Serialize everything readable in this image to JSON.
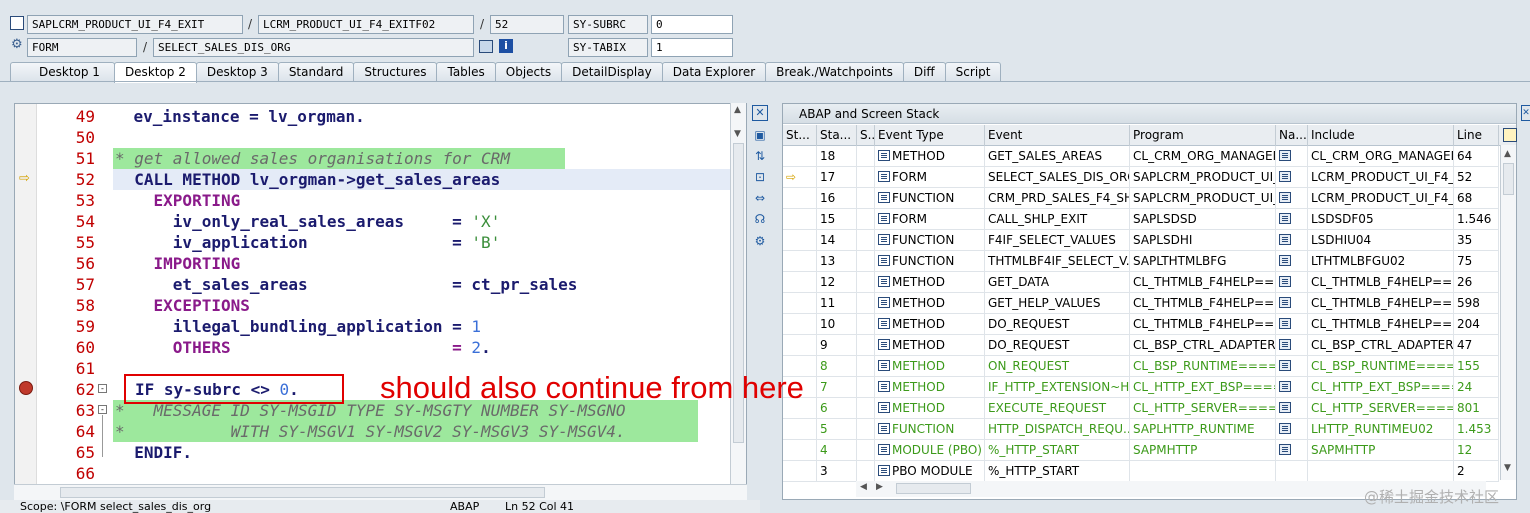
{
  "header": {
    "row1": {
      "program": "SAPLCRM_PRODUCT_UI_F4_EXIT",
      "include": "LCRM_PRODUCT_UI_F4_EXITF02",
      "line": "52",
      "sysvar_label": "SY-SUBRC",
      "sysvar_value": "0"
    },
    "row2": {
      "type": "FORM",
      "name": "SELECT_SALES_DIS_ORG",
      "sysvar_label": "SY-TABIX",
      "sysvar_value": "1"
    },
    "sep": "/"
  },
  "tabs": [
    "Desktop 1",
    "Desktop 2",
    "Desktop 3",
    "Standard",
    "Structures",
    "Tables",
    "Objects",
    "DetailDisplay",
    "Data Explorer",
    "Break./Watchpoints",
    "Diff",
    "Script"
  ],
  "active_tab": "Desktop 2",
  "editor": {
    "lines": [
      {
        "n": "49"
      },
      {
        "n": "50"
      },
      {
        "n": "51"
      },
      {
        "n": "52"
      },
      {
        "n": "53"
      },
      {
        "n": "54"
      },
      {
        "n": "55"
      },
      {
        "n": "56"
      },
      {
        "n": "57"
      },
      {
        "n": "58"
      },
      {
        "n": "59"
      },
      {
        "n": "60"
      },
      {
        "n": "61"
      },
      {
        "n": "62"
      },
      {
        "n": "63"
      },
      {
        "n": "64"
      },
      {
        "n": "65"
      },
      {
        "n": "66"
      }
    ],
    "code": {
      "l49": "    ev_instance = lv_orgman.",
      "l51": "* get allowed sales organisations for CRM",
      "l52a": "  CALL METHOD ",
      "l52b": "lv_orgman->get_sales_areas",
      "l53": "    EXPORTING",
      "l54a": "      iv_only_real_sales_areas     = ",
      "l54b": "'X'",
      "l55a": "      iv_application               = ",
      "l55b": "'B'",
      "l56": "    IMPORTING",
      "l57a": "      et_sales_areas               = ",
      "l57b": "ct_pr_sales",
      "l58": "    EXCEPTIONS",
      "l59a": "      illegal_bundling_application = ",
      "l59b": "1",
      "l60a": "      OTHERS                       = ",
      "l60b": "2",
      "l60c": ".",
      "l62a": "IF ",
      "l62b": "sy-subrc <> ",
      "l62c": "0",
      "l62d": ".",
      "l63": "*   MESSAGE ID SY-MSGID TYPE SY-MSGTY NUMBER SY-MSGNO",
      "l64": "*           WITH SY-MSGV1 SY-MSGV2 SY-MSGV3 SY-MSGV4.",
      "l65": "  ENDIF."
    }
  },
  "status_bar": {
    "scope": "Scope: \\FORM select_sales_dis_org",
    "lang": "ABAP",
    "pos": "Ln  52 Col  41"
  },
  "stack": {
    "title": "ABAP and Screen Stack",
    "columns": [
      "St...",
      "Sta...",
      "S..",
      "Event Type",
      "Event",
      "Program",
      "Na...",
      "Include",
      "Line"
    ],
    "rows": [
      {
        "sta": "18",
        "type": "METHOD",
        "event": "GET_SALES_AREAS",
        "program": "CL_CRM_ORG_MANAGEM...",
        "include": "CL_CRM_ORG_MANAGEM...",
        "line": "64",
        "green": false,
        "arrow": false
      },
      {
        "sta": "17",
        "type": "FORM",
        "event": "SELECT_SALES_DIS_ORG",
        "program": "SAPLCRM_PRODUCT_UI_...",
        "include": "LCRM_PRODUCT_UI_F4_...",
        "line": "52",
        "green": false,
        "arrow": true
      },
      {
        "sta": "16",
        "type": "FUNCTION",
        "event": "CRM_PRD_SALES_F4_SH...",
        "program": "SAPLCRM_PRODUCT_UI_...",
        "include": "LCRM_PRODUCT_UI_F4_...",
        "line": "68",
        "green": false,
        "arrow": false
      },
      {
        "sta": "15",
        "type": "FORM",
        "event": "CALL_SHLP_EXIT",
        "program": "SAPLSDSD",
        "include": "LSDSDF05",
        "line": "1.546",
        "green": false,
        "arrow": false
      },
      {
        "sta": "14",
        "type": "FUNCTION",
        "event": "F4IF_SELECT_VALUES",
        "program": "SAPLSDHI",
        "include": "LSDHIU04",
        "line": "35",
        "green": false,
        "arrow": false
      },
      {
        "sta": "13",
        "type": "FUNCTION",
        "event": "THTMLBF4IF_SELECT_V...",
        "program": "SAPLTHTMLBFG",
        "include": "LTHTMLBFGU02",
        "line": "75",
        "green": false,
        "arrow": false
      },
      {
        "sta": "12",
        "type": "METHOD",
        "event": "GET_DATA",
        "program": "CL_THTMLB_F4HELP==...",
        "include": "CL_THTMLB_F4HELP==...",
        "line": "26",
        "green": false,
        "arrow": false
      },
      {
        "sta": "11",
        "type": "METHOD",
        "event": "GET_HELP_VALUES",
        "program": "CL_THTMLB_F4HELP==...",
        "include": "CL_THTMLB_F4HELP==...",
        "line": "598",
        "green": false,
        "arrow": false
      },
      {
        "sta": "10",
        "type": "METHOD",
        "event": "DO_REQUEST",
        "program": "CL_THTMLB_F4HELP==...",
        "include": "CL_THTMLB_F4HELP==...",
        "line": "204",
        "green": false,
        "arrow": false
      },
      {
        "sta": "9",
        "type": "METHOD",
        "event": "DO_REQUEST",
        "program": "CL_BSP_CTRL_ADAPTER...",
        "include": "CL_BSP_CTRL_ADAPTER...",
        "line": "47",
        "green": false,
        "arrow": false
      },
      {
        "sta": "8",
        "type": "METHOD",
        "event": "ON_REQUEST",
        "program": "CL_BSP_RUNTIME=====...",
        "include": "CL_BSP_RUNTIME====...",
        "line": "155",
        "green": true,
        "arrow": false
      },
      {
        "sta": "7",
        "type": "METHOD",
        "event": "IF_HTTP_EXTENSION~H...",
        "program": "CL_HTTP_EXT_BSP====...",
        "include": "CL_HTTP_EXT_BSP====...",
        "line": "24",
        "green": true,
        "arrow": false
      },
      {
        "sta": "6",
        "type": "METHOD",
        "event": "EXECUTE_REQUEST",
        "program": "CL_HTTP_SERVER====...",
        "include": "CL_HTTP_SERVER====...",
        "line": "801",
        "green": true,
        "arrow": false
      },
      {
        "sta": "5",
        "type": "FUNCTION",
        "event": "HTTP_DISPATCH_REQU...",
        "program": "SAPLHTTP_RUNTIME",
        "include": "LHTTP_RUNTIMEU02",
        "line": "1.453",
        "green": true,
        "arrow": false
      },
      {
        "sta": "4",
        "type": "MODULE (PBO)",
        "event": "%_HTTP_START",
        "program": "SAPMHTTP",
        "include": "SAPMHTTP",
        "line": "12",
        "green": true,
        "arrow": false
      },
      {
        "sta": "3",
        "type": "PBO MODULE",
        "event": "%_HTTP_START",
        "program": "",
        "include": "",
        "line": "2",
        "green": false,
        "arrow": false
      }
    ]
  },
  "annotation": "should also continue from here",
  "watermark": "@稀土掘金技术社区",
  "colors": {
    "comment_bg": "#9de89d",
    "annotation": "#e00000",
    "line_number": "#c00000",
    "green_row": "#3c9a1a"
  }
}
